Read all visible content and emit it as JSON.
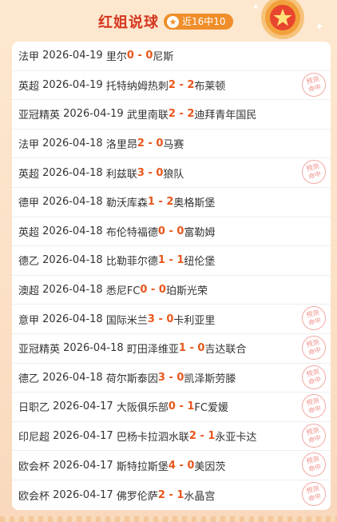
{
  "header": {
    "title": "红姐说球",
    "badge": "近16中10",
    "badge_icon": "star-icon"
  },
  "stamp_text": [
    "预测",
    "命中"
  ],
  "matches": [
    {
      "league": "法甲",
      "date": "2026-04-19",
      "home": "里尔",
      "home_score": "0",
      "sep": " - ",
      "away_score": "0",
      "away": "尼斯",
      "hit": false
    },
    {
      "league": "英超",
      "date": "2026-04-19",
      "home": "托特纳姆热刺",
      "home_score": "2",
      "sep": " - ",
      "away_score": "2",
      "away": "布莱顿",
      "hit": true
    },
    {
      "league": "亚冠精英",
      "date": "2026-04-19",
      "home": "武里南联",
      "home_score": "2",
      "sep": " - ",
      "away_score": "2",
      "away": "迪拜青年国民",
      "hit": false
    },
    {
      "league": "法甲",
      "date": "2026-04-18",
      "home": "洛里昂",
      "home_score": "2",
      "sep": " - ",
      "away_score": "0",
      "away": "马赛",
      "hit": false
    },
    {
      "league": "英超",
      "date": "2026-04-18",
      "home": "利兹联",
      "home_score": "3",
      "sep": " - ",
      "away_score": "0",
      "away": "狼队",
      "hit": true
    },
    {
      "league": "德甲",
      "date": "2026-04-18",
      "home": "勒沃库森",
      "home_score": "1",
      "sep": " - ",
      "away_score": "2",
      "away": "奥格斯堡",
      "hit": false
    },
    {
      "league": "英超",
      "date": "2026-04-18",
      "home": "布伦特福德",
      "home_score": "0",
      "sep": " - ",
      "away_score": "0",
      "away": "富勒姆",
      "hit": false
    },
    {
      "league": "德乙",
      "date": "2026-04-18",
      "home": "比勒菲尔德",
      "home_score": "1",
      "sep": " - ",
      "away_score": "1",
      "away": "纽伦堡",
      "hit": false
    },
    {
      "league": "澳超",
      "date": "2026-04-18",
      "home": "悉尼FC",
      "home_score": "0",
      "sep": " - ",
      "away_score": "0",
      "away": "珀斯光荣",
      "hit": false
    },
    {
      "league": "意甲",
      "date": "2026-04-18",
      "home": "国际米兰",
      "home_score": "3",
      "sep": " - ",
      "away_score": "0",
      "away": "卡利亚里",
      "hit": true
    },
    {
      "league": "亚冠精英",
      "date": "2026-04-18",
      "home": "町田泽维亚",
      "home_score": "1",
      "sep": " - ",
      "away_score": "0",
      "away": "吉达联合",
      "hit": true
    },
    {
      "league": "德乙",
      "date": "2026-04-18",
      "home": "荷尔斯泰因",
      "home_score": "3",
      "sep": " - ",
      "away_score": "0",
      "away": "凯泽斯劳滕",
      "hit": true
    },
    {
      "league": "日职乙",
      "date": "2026-04-17",
      "home": "大阪俱乐部",
      "home_score": "0",
      "sep": " - ",
      "away_score": "1",
      "away": "FC爱媛",
      "hit": true
    },
    {
      "league": "印尼超",
      "date": "2026-04-17",
      "home": "巴杨卡拉泗水联",
      "home_score": "2",
      "sep": " - ",
      "away_score": "1",
      "away": "永亚卡达",
      "hit": true
    },
    {
      "league": "欧会杯",
      "date": "2026-04-17",
      "home": "斯特拉斯堡",
      "home_score": "4",
      "sep": " - ",
      "away_score": "0",
      "away": "美因茨",
      "hit": true
    },
    {
      "league": "欧会杯",
      "date": "2026-04-17",
      "home": "佛罗伦萨",
      "home_score": "2",
      "sep": " - ",
      "away_score": "1",
      "away": "水晶宫",
      "hit": true
    }
  ],
  "colors": {
    "score": "#e8561c",
    "title": "#d4361f",
    "badge": "#ef8e2a"
  }
}
